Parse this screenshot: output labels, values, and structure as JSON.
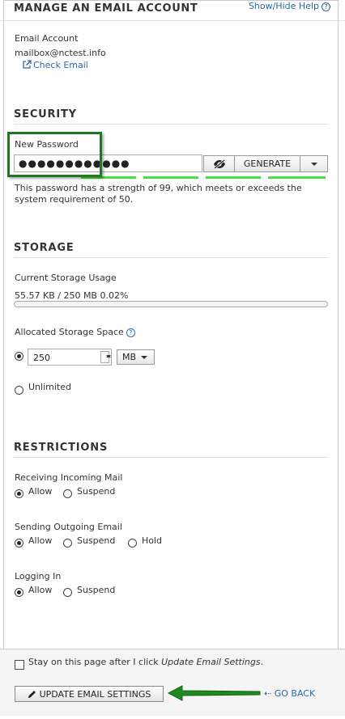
{
  "header": {
    "title": "MANAGE AN EMAIL ACCOUNT",
    "help_label": "Show/Hide Help"
  },
  "account": {
    "label": "Email Account",
    "address": "mailbox@nctest.info",
    "check_email_label": "Check Email"
  },
  "security": {
    "heading": "SECURITY",
    "new_password_label": "New Password",
    "password_value": "●●●●●●●●●●●●",
    "generate_label": "GENERATE",
    "strength_text_line1": "This password has a strength of 99, which meets or exceeds the",
    "strength_text_line2": "system requirement of 50.",
    "strength": 99,
    "required_strength": 50
  },
  "storage": {
    "heading": "STORAGE",
    "current_usage_label": "Current Storage Usage",
    "usage_text": "55.57 KB / 250 MB 0.02%",
    "usage_fraction": 0.0002,
    "allocated_label": "Allocated Storage Space",
    "quota_value": "250",
    "unit_value": "MB",
    "unlimited_label": "Unlimited",
    "quota_selected": "limited"
  },
  "restrictions": {
    "heading": "RESTRICTIONS",
    "incoming": {
      "label": "Receiving Incoming Mail",
      "options": [
        "Allow",
        "Suspend"
      ],
      "selected": "Allow"
    },
    "outgoing": {
      "label": "Sending Outgoing Email",
      "options": [
        "Allow",
        "Suspend",
        "Hold"
      ],
      "selected": "Allow"
    },
    "login": {
      "label": "Logging In",
      "options": [
        "Allow",
        "Suspend"
      ],
      "selected": "Allow"
    }
  },
  "footer": {
    "stay_prefix": "Stay on this page after I click ",
    "stay_emphasis": "Update Email Settings",
    "stay_suffix": ".",
    "update_label": "UPDATE EMAIL SETTINGS",
    "go_back_label": "GO BACK"
  },
  "colors": {
    "link": "#2a6aa8",
    "strength_bar": "#44e044",
    "annotation": "#1f7a1f"
  },
  "icons": {
    "help": "question-circle-icon",
    "check_email": "external-link-icon",
    "show_password": "eye-slash-icon",
    "update": "pencil-icon",
    "go_back": "arrow-left-icon"
  }
}
